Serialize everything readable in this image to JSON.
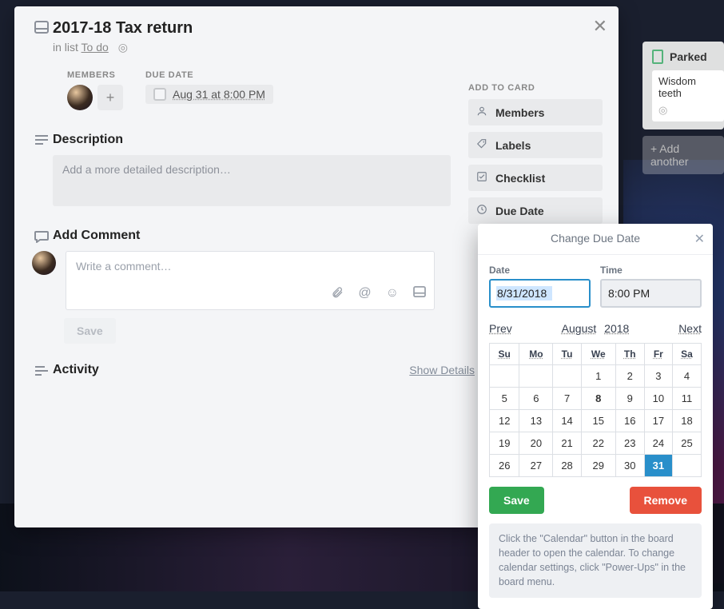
{
  "board": {
    "parked_list_title": "Parked",
    "parked_card": "Wisdom teeth",
    "add_another": "+ Add another"
  },
  "card": {
    "title": "2017-18 Tax return",
    "in_list_prefix": "in list ",
    "in_list_name": "To do",
    "members_label": "MEMBERS",
    "due_label": "DUE DATE",
    "due_text": "Aug 31 at 8:00 PM",
    "description_title": "Description",
    "description_placeholder": "Add a more detailed description…",
    "add_comment_title": "Add Comment",
    "comment_placeholder": "Write a comment…",
    "save_comment": "Save",
    "activity_title": "Activity",
    "show_details": "Show Details"
  },
  "rail": {
    "title": "ADD TO CARD",
    "members": "Members",
    "labels": "Labels",
    "checklist": "Checklist",
    "due_date": "Due Date"
  },
  "popover": {
    "title": "Change Due Date",
    "date_label": "Date",
    "time_label": "Time",
    "date_value": "8/31/2018",
    "time_value": "8:00 PM",
    "prev": "Prev",
    "month": "August",
    "year": "2018",
    "next": "Next",
    "dow": [
      "Su",
      "Mo",
      "Tu",
      "We",
      "Th",
      "Fr",
      "Sa"
    ],
    "weeks": [
      [
        "",
        "",
        "",
        "1",
        "2",
        "3",
        "4"
      ],
      [
        "5",
        "6",
        "7",
        "8",
        "9",
        "10",
        "11"
      ],
      [
        "12",
        "13",
        "14",
        "15",
        "16",
        "17",
        "18"
      ],
      [
        "19",
        "20",
        "21",
        "22",
        "23",
        "24",
        "25"
      ],
      [
        "26",
        "27",
        "28",
        "29",
        "30",
        "31",
        ""
      ]
    ],
    "today_day": "8",
    "selected_day": "31",
    "save": "Save",
    "remove": "Remove",
    "hint": "Click the \"Calendar\" button in the board header to open the calendar. To change calendar settings, click \"Power-Ups\" in the board menu."
  }
}
